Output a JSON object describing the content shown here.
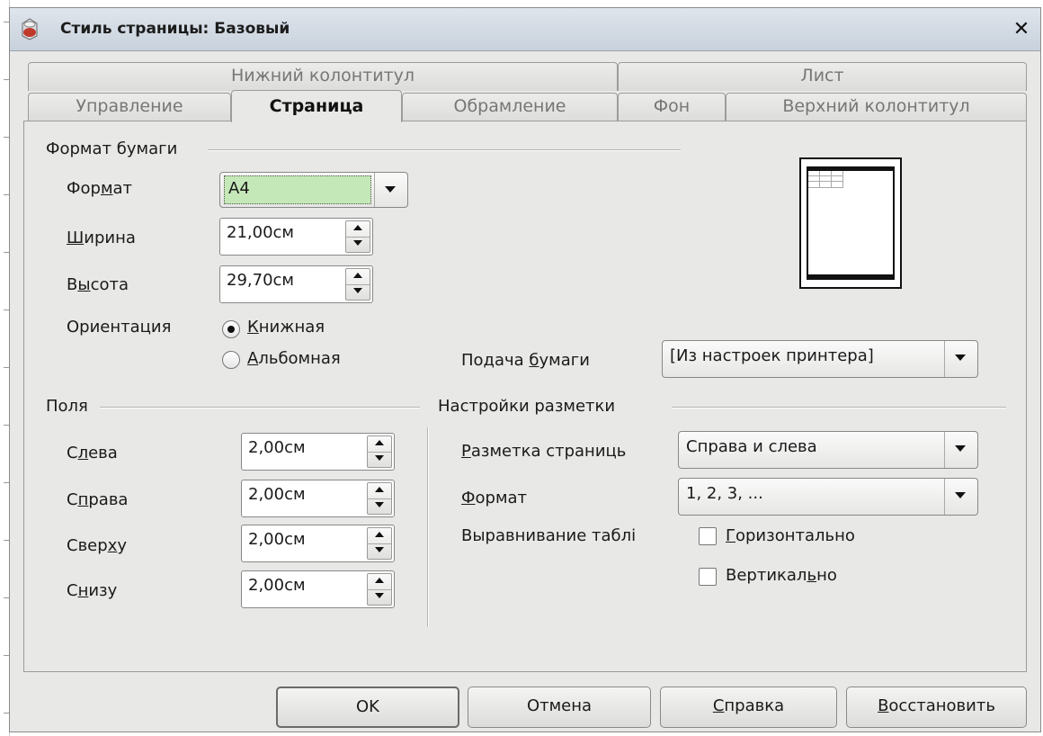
{
  "window": {
    "title": "Стиль страницы: Базовый",
    "close_glyph": "✕"
  },
  "tabs_row1": [
    {
      "label": "Нижний колонтитул"
    },
    {
      "label": "Лист"
    }
  ],
  "tabs_row2": [
    {
      "label": "Управление"
    },
    {
      "label": "Страница",
      "active": true
    },
    {
      "label": "Обрамление"
    },
    {
      "label": "Фон"
    },
    {
      "label": "Верхний колонтитул"
    }
  ],
  "paper": {
    "group_title": "Формат бумаги",
    "format_label_pre": "Фор",
    "format_label_u": "м",
    "format_label_post": "ат",
    "format_value": "A4",
    "width_label_u": "Ш",
    "width_label_post": "ирина",
    "width_value": "21,00см",
    "height_label_pre": "В",
    "height_label_u": "ы",
    "height_label_post": "сота",
    "height_value": "29,70см",
    "orientation_label": "Ориентация",
    "portrait_u": "К",
    "portrait_post": "нижная",
    "portrait_selected": true,
    "landscape_u": "А",
    "landscape_post": "льбомная",
    "tray_label_pre": "Подача ",
    "tray_label_u": "б",
    "tray_label_post": "умаги",
    "tray_value": "[Из настроек принтера]"
  },
  "margins": {
    "group_title": "Поля",
    "items": [
      {
        "pre": "С",
        "u": "л",
        "post": "ева",
        "value": "2,00см"
      },
      {
        "pre": "С",
        "u": "п",
        "post": "рава",
        "value": "2,00см"
      },
      {
        "pre": "Свер",
        "u": "х",
        "post": "у",
        "value": "2,00см"
      },
      {
        "pre": "С",
        "u": "н",
        "post": "изу",
        "value": "2,00см"
      }
    ]
  },
  "layout": {
    "group_title": "Настройки разметки",
    "page_layout_u": "Р",
    "page_layout_post": "азметка страниць",
    "page_layout_value": "Справа и слева",
    "format_u": "Ф",
    "format_post": "ормат",
    "format_value": "1, 2, 3, ...",
    "table_align_label": "Выравнивание таблі",
    "horizontal_u": "Г",
    "horizontal_post": "оризонтально",
    "horizontal_checked": false,
    "vertical_pre": "Вертикал",
    "vertical_u": "ь",
    "vertical_post": "но",
    "vertical_checked": false
  },
  "buttons": {
    "ok": "OK",
    "cancel": "Отмена",
    "help_u": "С",
    "help_post": "правка",
    "reset_u": "В",
    "reset_post": "осстановить"
  },
  "colors": {
    "selected_format_bg": "#c5e8b8",
    "titlebar": "#c8d1dc",
    "dialog_bg": "#e8e8e6"
  }
}
